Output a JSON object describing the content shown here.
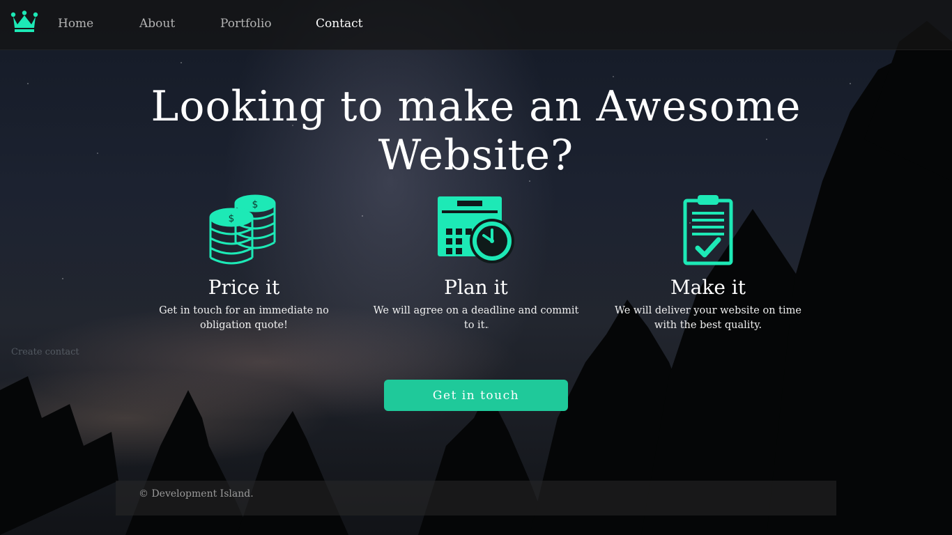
{
  "colors": {
    "accent": "#1de9b6",
    "button": "#1fc99a",
    "nav_text": "#b4b4b4",
    "nav_active": "#ffffff"
  },
  "navbar": {
    "logo_icon": "crown-icon",
    "links": [
      {
        "label": "Home"
      },
      {
        "label": "About"
      },
      {
        "label": "Portfolio"
      },
      {
        "label": "Contact"
      }
    ]
  },
  "hero": {
    "title": "Looking to make an Awesome Website?"
  },
  "features": [
    {
      "icon": "coins-icon",
      "title": "Price it",
      "text": "Get in touch for an immediate no obligation quote!"
    },
    {
      "icon": "calendar-clock-icon",
      "title": "Plan it",
      "text": "We will agree on a deadline and commit to it."
    },
    {
      "icon": "clipboard-check-icon",
      "title": "Make it",
      "text": "We will deliver your website on time with the best quality."
    }
  ],
  "ghost_text": "Create contact",
  "cta": {
    "label": "Get in touch"
  },
  "footer": {
    "text": "© Development Island."
  }
}
